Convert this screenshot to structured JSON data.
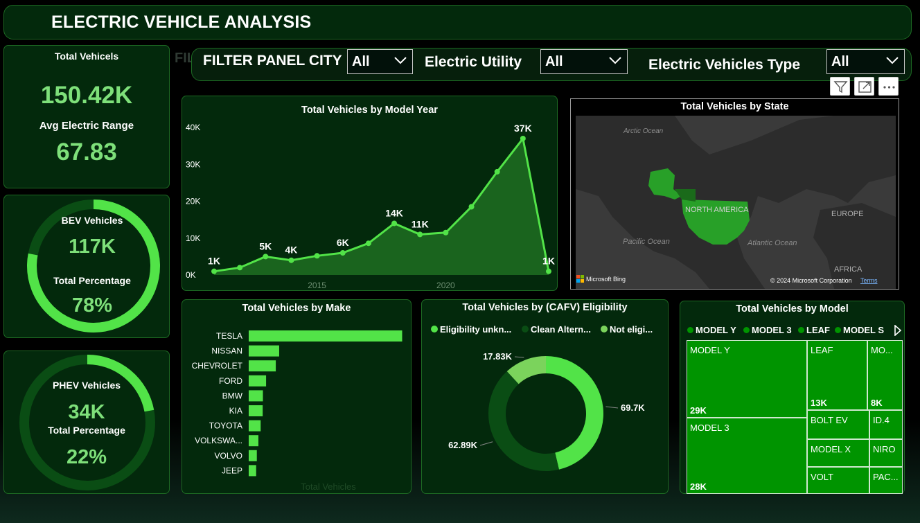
{
  "header": {
    "title": "ELECTRIC VEHICLE ANALYSIS",
    "ghost_text": "FILT"
  },
  "filters": {
    "city_label": "FILTER PANEL CITY",
    "city_value": "All",
    "utility_label": "Electric Utility",
    "utility_value": "All",
    "type_label": "Electric Vehicles Type",
    "type_value": "All"
  },
  "kpis": {
    "total_label": "Total Vehicels",
    "total_value": "150.42K",
    "range_label": "Avg Electric Range",
    "range_value": "67.83",
    "bev_label": "BEV Vehicles",
    "bev_value": "117K",
    "bev_pct_label": "Total Percentage",
    "bev_pct_value": "78%",
    "bev_pct": 78,
    "phev_label": "PHEV Vehicles",
    "phev_value": "34K",
    "phev_pct_label": "Total Percentage",
    "phev_pct_value": "22%",
    "phev_pct": 22
  },
  "colors": {
    "accent": "#52e348",
    "panel_bg": "#03290c",
    "panel_border": "#1d6a23",
    "dark_green": "#0a4d14",
    "light_green": "#7bd35c",
    "treemap": "#009400"
  },
  "visual_tools": {
    "icons": [
      "filter-icon",
      "focus-mode-icon",
      "more-options-icon"
    ]
  },
  "chart_data": [
    {
      "type": "area",
      "title": "Total Vehicles by Model Year",
      "x": [
        2011,
        2012,
        2013,
        2014,
        2015,
        2016,
        2017,
        2018,
        2019,
        2020,
        2021,
        2022,
        2023,
        2024
      ],
      "values": [
        1000,
        2000,
        5000,
        4000,
        5200,
        6000,
        8600,
        14000,
        11000,
        11500,
        18500,
        28000,
        37000,
        1000
      ],
      "data_labels": [
        "1K",
        "",
        "5K",
        "4K",
        "",
        "6K",
        "",
        "14K",
        "11K",
        "",
        "",
        "",
        "37K",
        "1K"
      ],
      "y_ticks": [
        "0K",
        "10K",
        "20K",
        "30K",
        "40K"
      ],
      "x_ticks": [
        "2015",
        "2020"
      ],
      "ylim": [
        0,
        40000
      ]
    },
    {
      "type": "map",
      "title": "Total Vehicles by State",
      "labels": [
        "Arctic Ocean",
        "NORTH AMERICA",
        "Pacific Ocean",
        "Atlantic Ocean",
        "EUROPE",
        "AFRICA"
      ],
      "attribution": "Microsoft Bing",
      "copyright": "© 2024 Microsoft Corporation",
      "terms": "Terms"
    },
    {
      "type": "bar",
      "title": "Total Vehicles by Make",
      "categories": [
        "TESLA",
        "NISSAN",
        "CHEVROLET",
        "FORD",
        "BMW",
        "KIA",
        "TOYOTA",
        "VOLKSWA...",
        "VOLVO",
        "JEEP"
      ],
      "values": [
        68000,
        13500,
        12000,
        7700,
        6300,
        6200,
        5300,
        4300,
        3600,
        3300
      ],
      "xlabel": "Total Vehicles",
      "xlim": [
        0,
        70000
      ]
    },
    {
      "type": "pie",
      "title": "Total Vehicles by (CAFV) Eligibility",
      "legend": [
        "Eligibility unkn...",
        "Clean Altern...",
        "Not eligi..."
      ],
      "legend_colors": [
        "#52e348",
        "#0a4d14",
        "#7bd35c"
      ],
      "slices": [
        {
          "name": "Eligibility unknown",
          "value": 69.7,
          "label": "69.7K",
          "color": "#52e348"
        },
        {
          "name": "Clean Alternative",
          "value": 62.89,
          "label": "62.89K",
          "color": "#0a4d14"
        },
        {
          "name": "Not eligible",
          "value": 17.83,
          "label": "17.83K",
          "color": "#7bd35c"
        }
      ]
    },
    {
      "type": "treemap",
      "title": "Total Vehicles by Model",
      "legend": [
        "MODEL Y",
        "MODEL 3",
        "LEAF",
        "MODEL S"
      ],
      "tiles": [
        {
          "name": "MODEL Y",
          "value": "29K"
        },
        {
          "name": "MODEL 3",
          "value": "28K"
        },
        {
          "name": "LEAF",
          "value": "13K"
        },
        {
          "name": "MO...",
          "value": "8K"
        },
        {
          "name": "BOLT EV",
          "value": ""
        },
        {
          "name": "ID.4",
          "value": ""
        },
        {
          "name": "MODEL X",
          "value": ""
        },
        {
          "name": "NIRO",
          "value": ""
        },
        {
          "name": "VOLT",
          "value": ""
        },
        {
          "name": "PAC...",
          "value": ""
        }
      ]
    }
  ]
}
